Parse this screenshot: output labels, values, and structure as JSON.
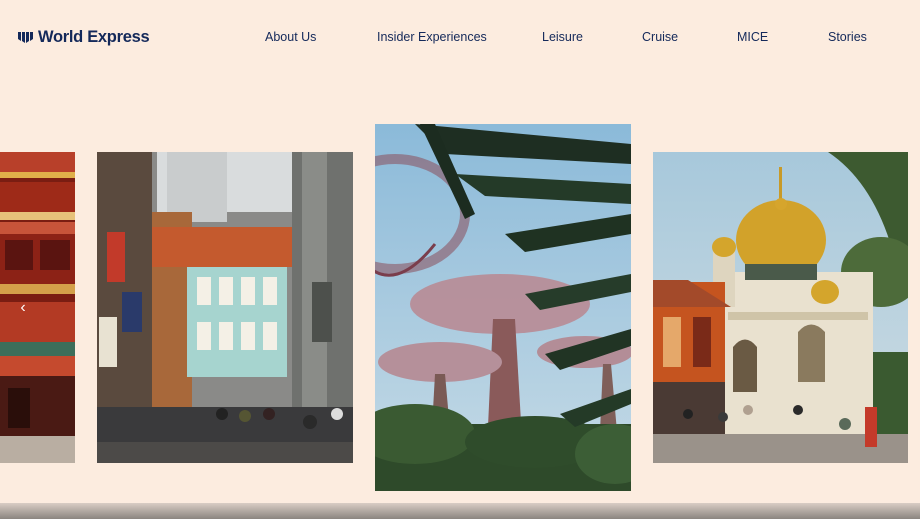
{
  "brand": {
    "name": "World Express",
    "logo_icon": "brand-logo-icon"
  },
  "nav": {
    "items": [
      {
        "label": "About Us"
      },
      {
        "label": "Insider Experiences"
      },
      {
        "label": "Leisure"
      },
      {
        "label": "Cruise"
      },
      {
        "label": "MICE"
      },
      {
        "label": "Stories"
      }
    ]
  },
  "carousel": {
    "prev_icon": "chevron-left-icon",
    "slides": [
      {
        "subject": "chinese-temple-facade"
      },
      {
        "subject": "chinatown-shophouse-street"
      },
      {
        "subject": "supertree-grove"
      },
      {
        "subject": "golden-dome-mosque"
      }
    ]
  },
  "colors": {
    "background": "#fcecdf",
    "brand_navy": "#14295a"
  }
}
